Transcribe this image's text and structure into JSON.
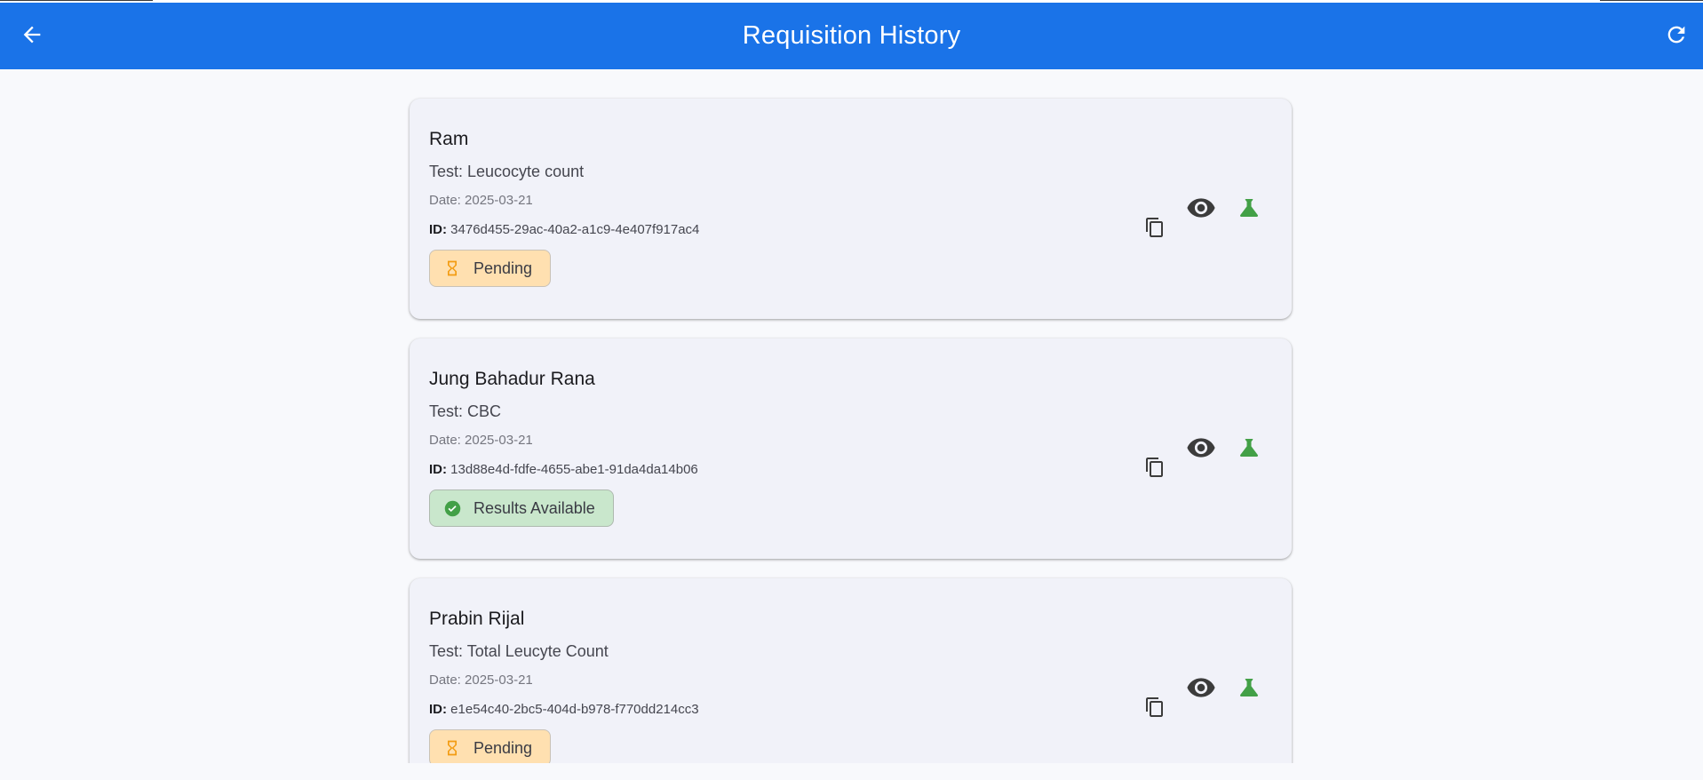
{
  "appbar": {
    "title": "Requisition History",
    "back_icon": "arrow-back-icon",
    "refresh_icon": "refresh-icon",
    "color": "#1a73e8"
  },
  "requisitions": [
    {
      "name": "Ram",
      "test": "Test: Leucocyte count",
      "date": "Date: 2025-03-21",
      "id_label": "ID:",
      "id_value": "3476d455-29ac-40a2-a1c9-4e407f917ac4",
      "status": "Pending",
      "status_type": "pending",
      "status_icon": "hourglass-icon"
    },
    {
      "name": "Jung Bahadur Rana",
      "test": "Test: CBC",
      "date": "Date: 2025-03-21",
      "id_label": "ID:",
      "id_value": "13d88e4d-fdfe-4655-abe1-91da4da14b06",
      "status": "Results Available",
      "status_type": "results",
      "status_icon": "check-circle-icon"
    },
    {
      "name": "Prabin Rijal",
      "test": "Test: Total Leucyte Count",
      "date": "Date: 2025-03-21",
      "id_label": "ID:",
      "id_value": "e1e54c40-2bc5-404d-b978-f770dd214cc3",
      "status": "Pending",
      "status_type": "pending",
      "status_icon": "hourglass-icon"
    }
  ],
  "colors": {
    "pending_chip": "#ffe0b0",
    "pending_icon": "#f39c12",
    "results_chip": "#c9e7cc",
    "results_icon": "#43a047",
    "lab_icon": "#43a047",
    "view_icon": "#3c3c3c"
  }
}
